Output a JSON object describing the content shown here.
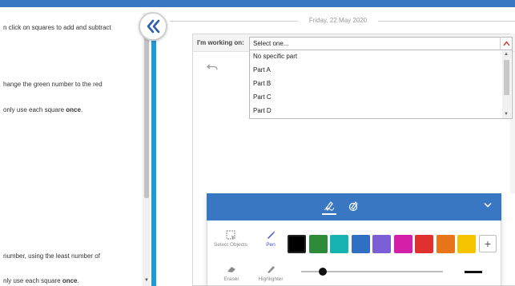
{
  "instructions": {
    "line1": "n click on squares to add and subtract",
    "line2": "hange the green number to the red",
    "line3_prefix": "only use each square ",
    "line3_bold": "once",
    "line3_suffix": ".",
    "line4": "number, using the least number of",
    "line5_prefix": "nly use each square ",
    "line5_bold": "once",
    "line5_suffix": "."
  },
  "header": {
    "date": "Friday, 22 May 2020"
  },
  "working_on": {
    "label": "I'm working on:",
    "selected": "Select one...",
    "options": [
      "No specific part",
      "Part A",
      "Part B",
      "Part C",
      "Part D"
    ]
  },
  "icons": {
    "collapse": "double-chevron-left-icon",
    "undo": "undo-icon",
    "pen_mode": "pen-mode-icon",
    "shape_mode": "shape-mode-icon",
    "toolbar_toggle": "chevron-down-icon"
  },
  "toolbar": {
    "tools": {
      "select_objects": "Select Objects",
      "pen": "Pen",
      "eraser": "Eraser",
      "highlighter": "Highlighter"
    },
    "active_tool": "Pen",
    "add_color": "+",
    "colors": [
      "#000000",
      "#2e8b3a",
      "#17b3b0",
      "#2f6fc4",
      "#7a5fd6",
      "#d41fa8",
      "#e03131",
      "#e8751a",
      "#f5c400"
    ],
    "selected_color": "#000000",
    "stroke_size": 0.15
  },
  "theme": {
    "accent": "#3a77c3",
    "divider": "#1d9bd9"
  }
}
